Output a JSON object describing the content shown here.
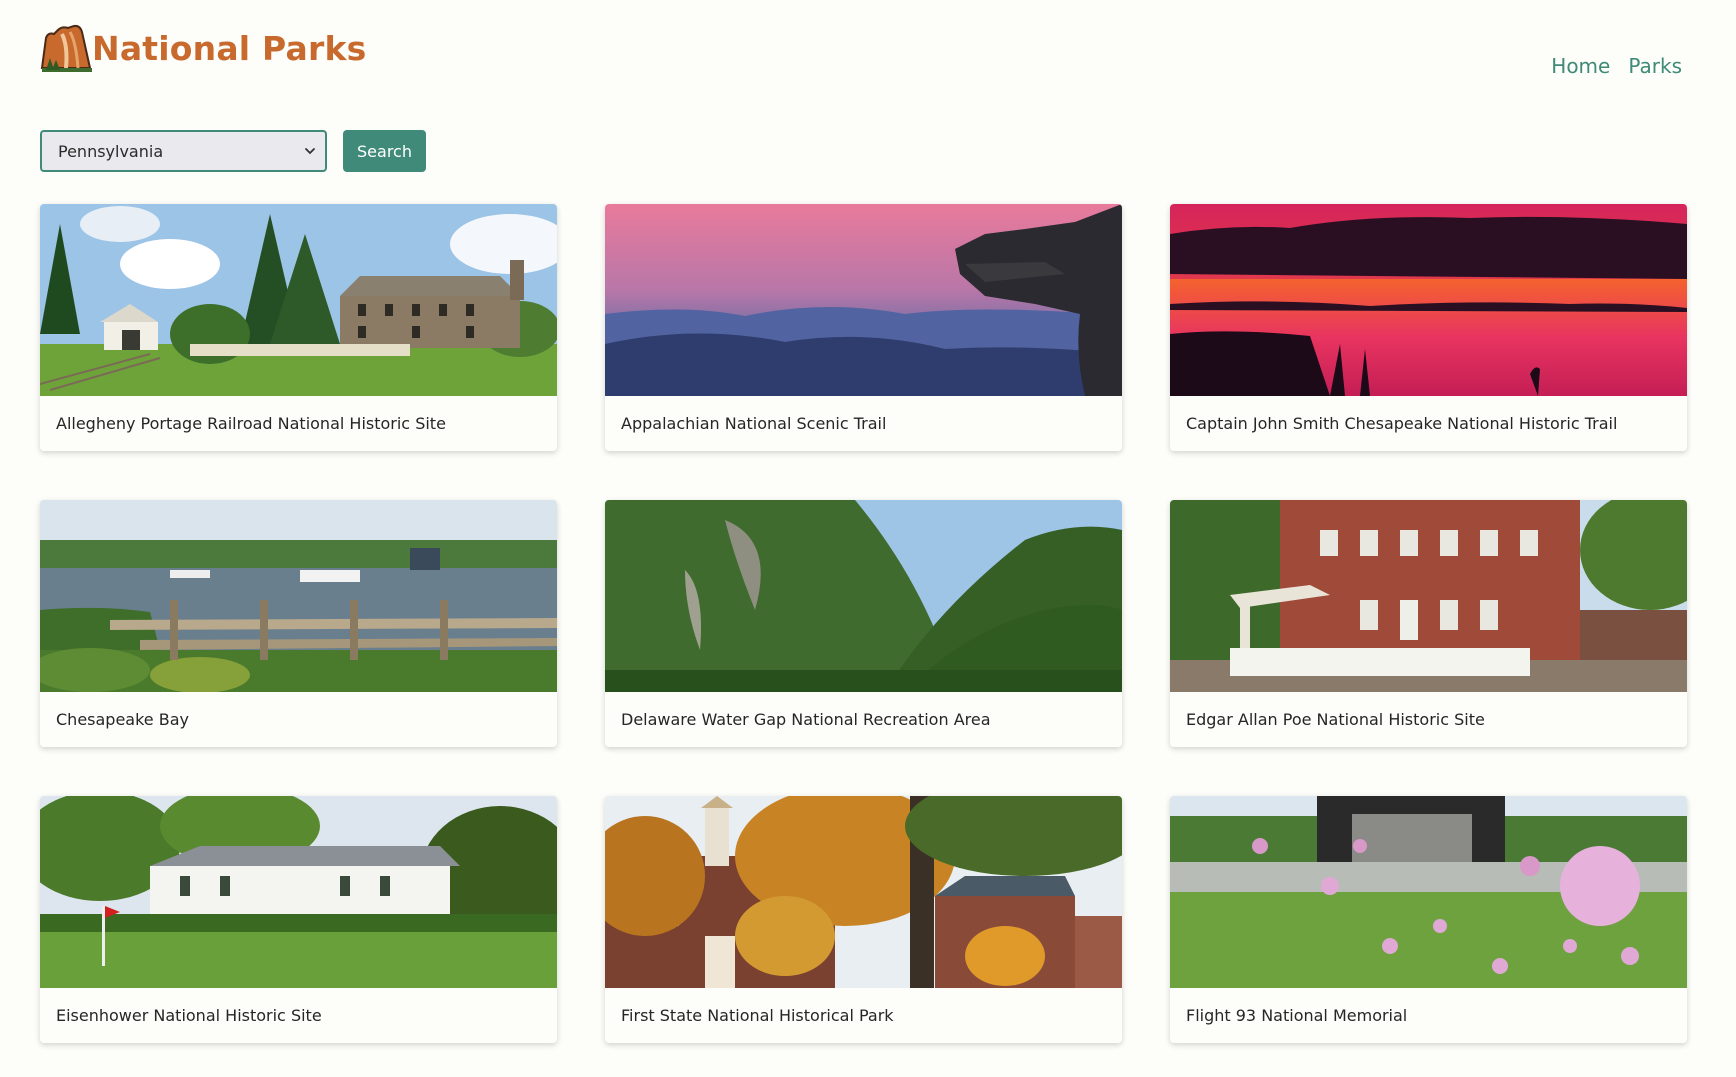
{
  "app": {
    "brand_name": "National Parks",
    "logo_icon": "mountain-logo-icon",
    "brand_color": "#c8692d",
    "accent_color": "#3f8a78"
  },
  "nav": {
    "items": [
      {
        "label": "Home"
      },
      {
        "label": "Parks"
      }
    ]
  },
  "search": {
    "selected_state": "Pennsylvania",
    "button_label": "Search"
  },
  "parks": [
    {
      "title": "Allegheny Portage Railroad National Historic Site",
      "image": "stone-house-railroad"
    },
    {
      "title": "Appalachian National Scenic Trail",
      "image": "mountain-sunset-ledge"
    },
    {
      "title": "Captain John Smith Chesapeake National Historic Trail",
      "image": "red-sunset-marsh"
    },
    {
      "title": "Chesapeake Bay",
      "image": "marina-docks"
    },
    {
      "title": "Delaware Water Gap National Recreation Area",
      "image": "forested-gap"
    },
    {
      "title": "Edgar Allan Poe National Historic Site",
      "image": "brick-house-fence"
    },
    {
      "title": "Eisenhower National Historic Site",
      "image": "white-farmhouse-lawn"
    },
    {
      "title": "First State National Historical Park",
      "image": "autumn-courthouse"
    },
    {
      "title": "Flight 93 National Memorial",
      "image": "memorial-wildflowers"
    }
  ]
}
